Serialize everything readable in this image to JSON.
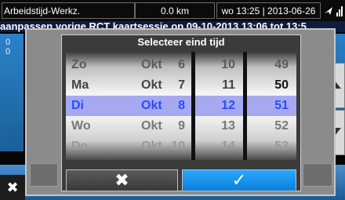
{
  "statusbar": {
    "title": "Arbeidstijd-Werkz.",
    "distance": "0.0 km",
    "datetime": "wo 13:25 | 2013-06-26"
  },
  "background": {
    "marquee": "aanpassen vorige RCT kaartsessie op 09-10-2013 13:06 tot 13:5",
    "left_digits": [
      "0",
      "0"
    ]
  },
  "dialog": {
    "title": "Selecteer eind tijd",
    "date_column": [
      {
        "weekday": "Zo",
        "month": "Okt",
        "day": "6"
      },
      {
        "weekday": "Ma",
        "month": "Okt",
        "day": "7"
      },
      {
        "weekday": "Di",
        "month": "Okt",
        "day": "8"
      },
      {
        "weekday": "Wo",
        "month": "Okt",
        "day": "9"
      },
      {
        "weekday": "Do",
        "month": "Okt",
        "day": "10"
      }
    ],
    "hour_column": [
      "10",
      "11",
      "12",
      "13",
      "14"
    ],
    "minute_column": [
      "49",
      "50",
      "51",
      "52",
      "53"
    ],
    "selected_index": 2,
    "cancel_symbol": "✖",
    "ok_symbol": "✓"
  },
  "colors": {
    "selection": "#a6a9f0",
    "selected_text": "#2a4bff",
    "ok_button": "#1a93f0"
  }
}
